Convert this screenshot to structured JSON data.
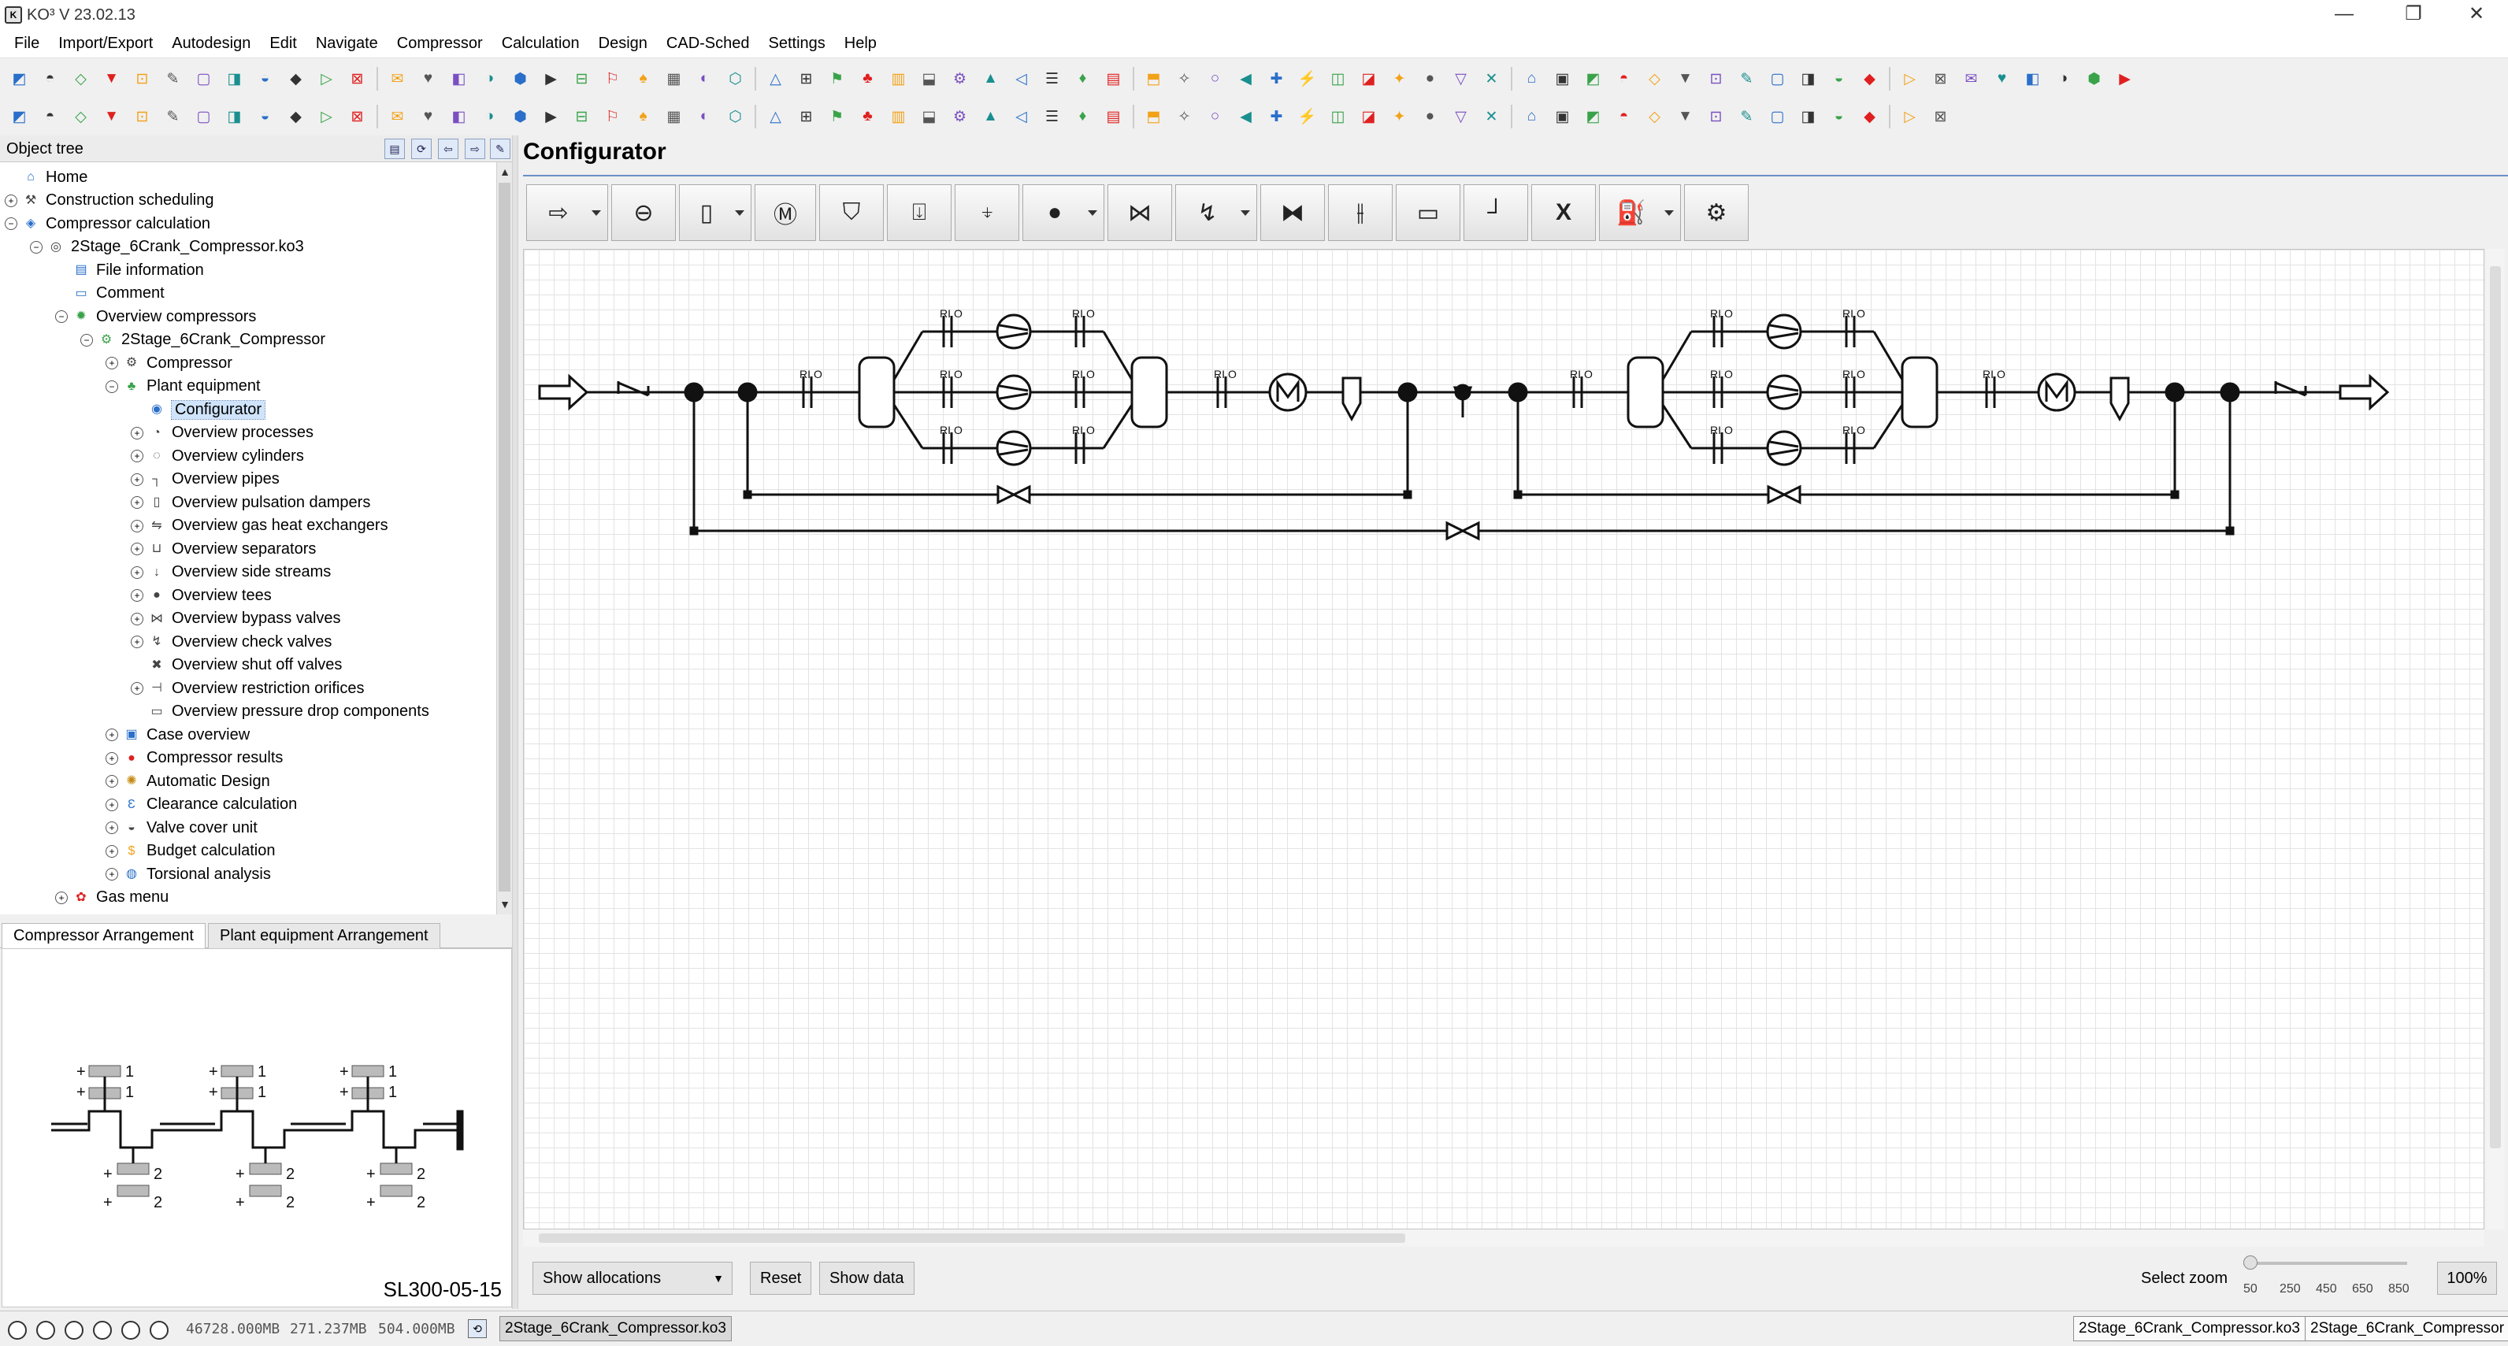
{
  "window": {
    "title": "KO³ V 23.02.13",
    "minimize": "—",
    "maximize": "❐",
    "close": "✕"
  },
  "menu": [
    "File",
    "Import/Export",
    "Autodesign",
    "Edit",
    "Navigate",
    "Compressor",
    "Calculation",
    "Design",
    "CAD-Sched",
    "Settings",
    "Help"
  ],
  "toolbar1_icons": [
    "new-icon",
    "open-icon",
    "save-icon",
    "save-all-icon",
    "print-icon",
    "print-preview-icon",
    "lock-icon",
    "lock-open-icon",
    "folder-lock-icon",
    "lock-key-icon",
    "api-icon",
    "vd-icon",
    "globe-icon",
    "doc-icon",
    "doc-link-icon",
    "doc-copy-icon",
    "doc-blue-icon",
    "doc-red-icon",
    "grid-icon",
    "compressor-icon",
    "building-icon",
    "pipe-icon",
    "chart-icon",
    "screen-icon",
    "sun-icon",
    "tool-icon",
    "home-icon",
    "link-icon",
    "bracket-icon",
    "fork-icon",
    "arrow-left-icon",
    "arrow-right-icon",
    "caret-up-icon",
    "copy-icon",
    "cut-icon",
    "paste-icon",
    "delete-icon",
    "scale-icon",
    "hatch-icon",
    "graph-icon",
    "leaf-icon",
    "arrow-icon",
    "gauge-icon",
    "slash-icon",
    "epsilon-icon",
    "epsilon2-icon",
    "valve-icon",
    "orifice-icon",
    "bars-icon",
    "kg-icon",
    "kg2-icon",
    "dots-icon",
    "drop-icon",
    "disk-icon",
    "hook-icon",
    "cloud-icon",
    "tree-icon",
    "globe2-icon",
    "columns-icon",
    "t-icon",
    "chart2-icon",
    "tag-icon",
    "hand-icon",
    "link2-icon",
    "gear-bars-icon",
    "gear-bars2-icon",
    "gear-bars3-icon",
    "gear-bars4-icon"
  ],
  "toolbar2_icons": [
    "tool1-icon",
    "tool2-icon",
    "tool3-icon",
    "tool4-icon",
    "tool5-icon",
    "tool6-icon",
    "tool7-icon",
    "tool8-icon",
    "tool9-icon",
    "tool10-icon",
    "tool11-icon",
    "tool12-icon",
    "tool13-icon",
    "tool14-icon",
    "tool15-icon",
    "tool16-icon",
    "tool17-icon",
    "tool18-icon",
    "tool19-icon",
    "tool20-icon",
    "tool21-icon",
    "tool22-icon",
    "tool23-icon",
    "tool24-icon",
    "tool25-icon",
    "tool26-icon",
    "tool27-icon",
    "tool28-icon",
    "tool29-icon",
    "tool30-icon",
    "tool31-icon",
    "tool32-icon",
    "tool33-icon",
    "tool34-icon",
    "tool35-icon",
    "tool36-icon",
    "tool37-icon",
    "tool38-icon",
    "tool39-icon",
    "tool40-icon",
    "tool41-icon",
    "tool42-icon",
    "tool43-icon",
    "tool44-icon",
    "tool45-icon",
    "tool46-icon",
    "tool47-icon",
    "tool48-icon",
    "tool49-icon",
    "tool50-icon",
    "tool51-icon",
    "tool52-icon",
    "tool53-icon",
    "tool54-icon",
    "tool55-icon",
    "tool56-icon",
    "tool57-icon",
    "tool58-icon",
    "tool59-icon",
    "tool60-icon",
    "tool61-icon",
    "tool62-icon"
  ],
  "tree": {
    "header": "Object tree",
    "items": [
      {
        "label": "Home",
        "level": 0,
        "toggle": "",
        "icon": "home-icon"
      },
      {
        "label": "Construction scheduling",
        "level": 0,
        "toggle": "+",
        "icon": "construction-icon"
      },
      {
        "label": "Compressor calculation",
        "level": 0,
        "toggle": "−",
        "icon": "calculation-icon"
      },
      {
        "label": "2Stage_6Crank_Compressor.ko3",
        "level": 1,
        "toggle": "−",
        "icon": "project-file-icon"
      },
      {
        "label": "File information",
        "level": 2,
        "toggle": "",
        "icon": "file-info-icon"
      },
      {
        "label": "Comment",
        "level": 2,
        "toggle": "",
        "icon": "comment-icon"
      },
      {
        "label": "Overview compressors",
        "level": 2,
        "toggle": "−",
        "icon": "compressors-icon"
      },
      {
        "label": "2Stage_6Crank_Compressor",
        "level": 3,
        "toggle": "−",
        "icon": "compressor-node-icon"
      },
      {
        "label": "Compressor",
        "level": 4,
        "toggle": "+",
        "icon": "compressor-icon"
      },
      {
        "label": "Plant equipment",
        "level": 4,
        "toggle": "−",
        "icon": "plant-equipment-icon"
      },
      {
        "label": "Configurator",
        "level": 5,
        "toggle": "",
        "icon": "configurator-icon",
        "selected": true
      },
      {
        "label": "Overview processes",
        "level": 5,
        "toggle": "+",
        "icon": "processes-icon"
      },
      {
        "label": "Overview cylinders",
        "level": 5,
        "toggle": "+",
        "icon": "cylinders-icon"
      },
      {
        "label": "Overview pipes",
        "level": 5,
        "toggle": "+",
        "icon": "pipes-icon"
      },
      {
        "label": "Overview pulsation dampers",
        "level": 5,
        "toggle": "+",
        "icon": "dampers-icon"
      },
      {
        "label": "Overview gas heat exchangers",
        "level": 5,
        "toggle": "+",
        "icon": "heat-exchanger-icon"
      },
      {
        "label": "Overview separators",
        "level": 5,
        "toggle": "+",
        "icon": "separator-icon"
      },
      {
        "label": "Overview side streams",
        "level": 5,
        "toggle": "+",
        "icon": "side-stream-icon"
      },
      {
        "label": "Overview tees",
        "level": 5,
        "toggle": "+",
        "icon": "tee-icon"
      },
      {
        "label": "Overview bypass valves",
        "level": 5,
        "toggle": "+",
        "icon": "bypass-valve-icon"
      },
      {
        "label": "Overview check valves",
        "level": 5,
        "toggle": "+",
        "icon": "check-valve-icon"
      },
      {
        "label": "Overview shut off valves",
        "level": 5,
        "toggle": "",
        "icon": "shutoff-valve-icon"
      },
      {
        "label": "Overview restriction orifices",
        "level": 5,
        "toggle": "+",
        "icon": "orifice-icon"
      },
      {
        "label": "Overview pressure drop components",
        "level": 5,
        "toggle": "",
        "icon": "pressure-drop-icon"
      },
      {
        "label": "Case overview",
        "level": 4,
        "toggle": "+",
        "icon": "case-icon"
      },
      {
        "label": "Compressor results",
        "level": 4,
        "toggle": "+",
        "icon": "results-icon"
      },
      {
        "label": "Automatic Design",
        "level": 4,
        "toggle": "+",
        "icon": "auto-design-icon"
      },
      {
        "label": "Clearance calculation",
        "level": 4,
        "toggle": "+",
        "icon": "clearance-icon"
      },
      {
        "label": "Valve cover unit",
        "level": 4,
        "toggle": "+",
        "icon": "valve-cover-icon"
      },
      {
        "label": "Budget calculation",
        "level": 4,
        "toggle": "+",
        "icon": "budget-icon"
      },
      {
        "label": "Torsional analysis",
        "level": 4,
        "toggle": "+",
        "icon": "torsional-icon"
      },
      {
        "label": "Gas menu",
        "level": 2,
        "toggle": "+",
        "icon": "gas-menu-icon"
      }
    ]
  },
  "tabs": [
    {
      "label": "Compressor Arrangement",
      "active": true
    },
    {
      "label": "Plant equipment Arrangement",
      "active": false
    }
  ],
  "arrangement": {
    "model": "SL300-05-15",
    "top_labels": [
      "1",
      "1"
    ],
    "bottom_labels": [
      "2",
      "2"
    ],
    "plus": "+"
  },
  "configurator": {
    "title": "Configurator",
    "palette_icons": [
      "flow-arrow-icon",
      "compressor-symbol-icon",
      "vessel-icon",
      "motor-icon",
      "separator-symbol-icon",
      "side-inlet-icon",
      "side-outlet-icon",
      "tee-node-icon",
      "bypass-valve-icon",
      "check-valve-icon",
      "shutoff-valve-icon",
      "orifice-icon",
      "pressure-drop-icon",
      "end-cap-icon",
      "delete-icon",
      "cooler-icon",
      "settings-gears-icon"
    ],
    "palette_dropdowns": [
      true,
      false,
      true,
      false,
      false,
      false,
      false,
      true,
      false,
      true,
      false,
      false,
      false,
      false,
      false,
      true,
      false
    ],
    "pal_glyph_delete": "X",
    "ri_label": "RI",
    "o_label": "O",
    "controls": {
      "show_allocations": "Show allocations",
      "reset": "Reset",
      "show_data": "Show data",
      "zoom_label": "Select zoom",
      "zoom_ticks": [
        "50",
        "250",
        "450",
        "650",
        "850"
      ],
      "zoom_value": "100%",
      "zoom_level_percent": 100
    }
  },
  "status": {
    "mem1": "46728.000MB",
    "mem2": "271.237MB",
    "mem3": "504.000MB",
    "file_tab": "2Stage_6Crank_Compressor.ko3",
    "right1": "2Stage_6Crank_Compressor.ko3",
    "right2": "2Stage_6Crank_Compressor"
  },
  "colors": {
    "accent_line": "#6b8fc8",
    "selected_bg": "#cfe4fa",
    "icon_red": "#e02020",
    "icon_green": "#3aa34a",
    "icon_blue": "#2a6fc9",
    "icon_orange": "#f2a218"
  }
}
